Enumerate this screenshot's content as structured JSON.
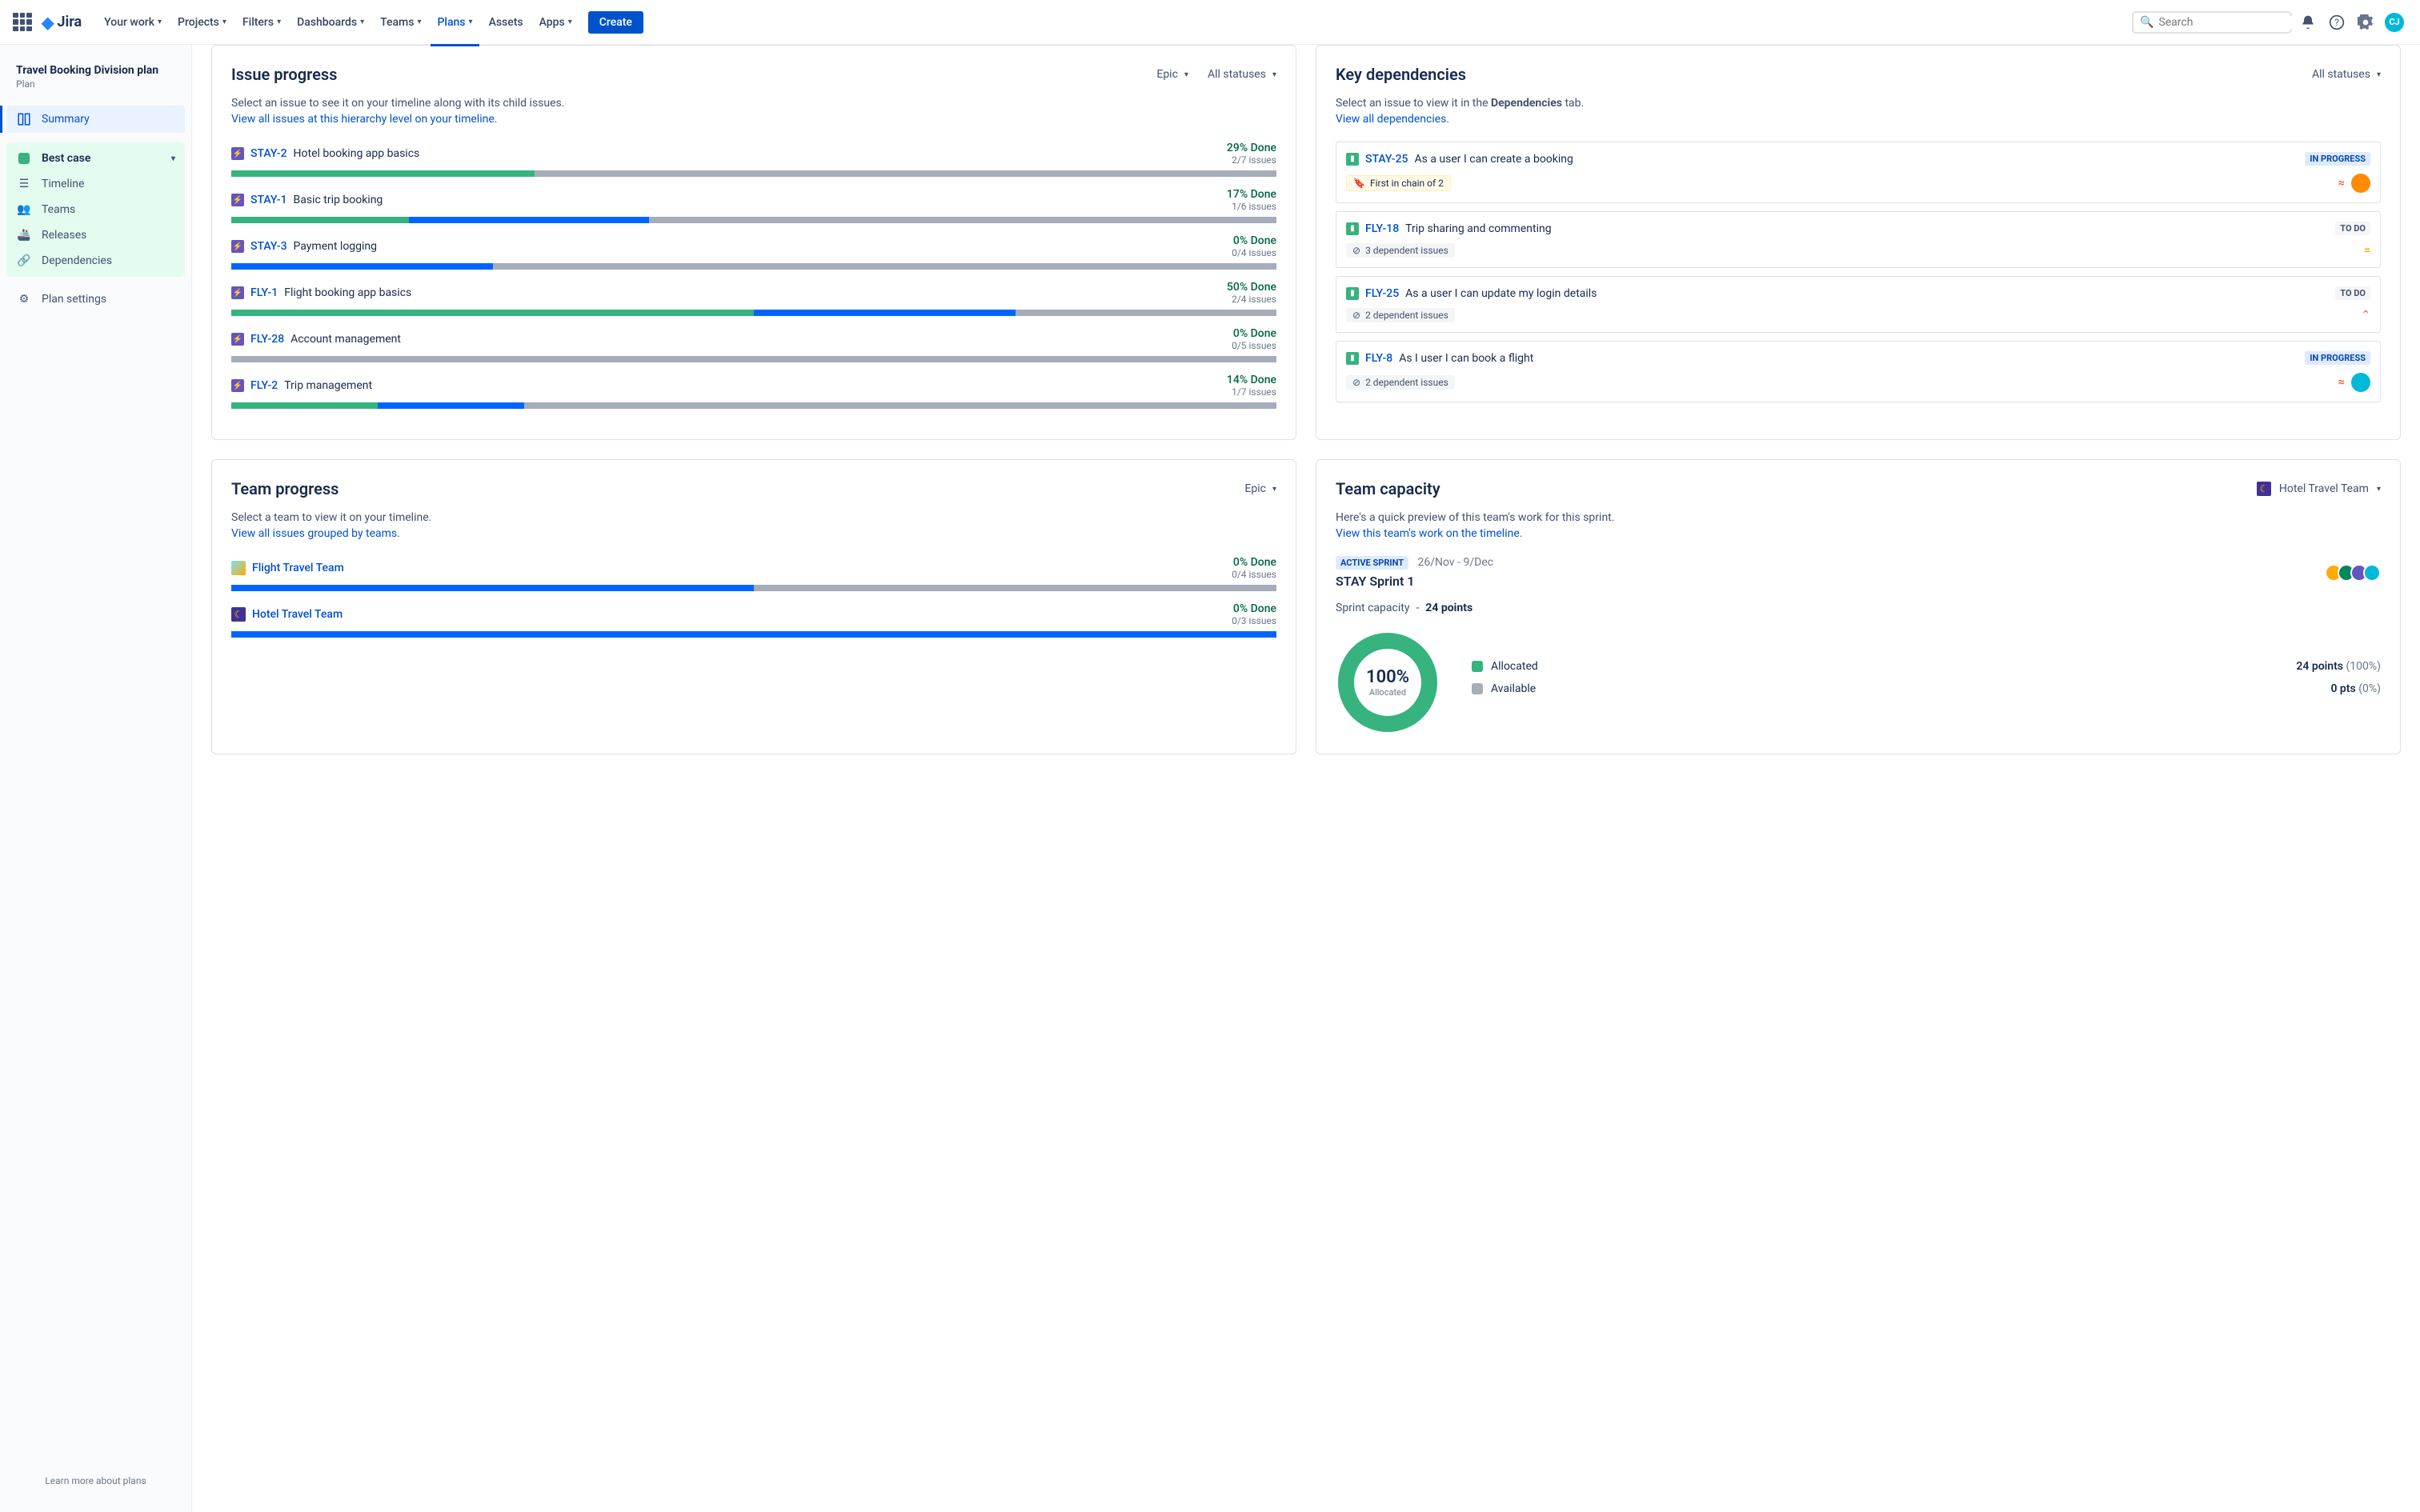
{
  "nav": {
    "logo": "Jira",
    "items": [
      "Your work",
      "Projects",
      "Filters",
      "Dashboards",
      "Teams",
      "Plans",
      "Assets",
      "Apps"
    ],
    "create": "Create",
    "search_placeholder": "Search"
  },
  "sidebar": {
    "plan_title": "Travel Booking Division plan",
    "plan_sub": "Plan",
    "summary": "Summary",
    "scenario": "Best case",
    "items": [
      "Timeline",
      "Teams",
      "Releases",
      "Dependencies"
    ],
    "settings": "Plan settings",
    "footer": "Learn more about plans"
  },
  "issue_progress": {
    "title": "Issue progress",
    "filter1": "Epic",
    "filter2": "All statuses",
    "desc": "Select an issue to see it on your timeline along with its child issues.",
    "link": "View all issues at this hierarchy level on your timeline.",
    "rows": [
      {
        "key": "STAY-2",
        "title": "Hotel booking app basics",
        "pct": "29% Done",
        "count": "2/7 issues",
        "green": 29,
        "blue": 0,
        "grey": 71
      },
      {
        "key": "STAY-1",
        "title": "Basic trip booking",
        "pct": "17% Done",
        "count": "1/6 issues",
        "green": 17,
        "blue": 23,
        "grey": 60
      },
      {
        "key": "STAY-3",
        "title": "Payment logging",
        "pct": "0% Done",
        "count": "0/4 issues",
        "green": 0,
        "blue": 25,
        "grey": 75
      },
      {
        "key": "FLY-1",
        "title": "Flight booking app basics",
        "pct": "50% Done",
        "count": "2/4 issues",
        "green": 50,
        "blue": 25,
        "grey": 25
      },
      {
        "key": "FLY-28",
        "title": "Account management",
        "pct": "0% Done",
        "count": "0/5 issues",
        "green": 0,
        "blue": 0,
        "grey": 100
      },
      {
        "key": "FLY-2",
        "title": "Trip management",
        "pct": "14% Done",
        "count": "1/7 issues",
        "green": 14,
        "blue": 14,
        "grey": 72
      }
    ]
  },
  "deps": {
    "title": "Key dependencies",
    "filter": "All statuses",
    "desc_a": "Select an issue to view it in the ",
    "desc_b": "Dependencies",
    "desc_c": " tab.",
    "link": "View all dependencies.",
    "rows": [
      {
        "key": "STAY-25",
        "title": "As a user I can create a booking",
        "status": "IN PROGRESS",
        "chain": "First in chain of 2",
        "prio": "highest",
        "avatar": "#FF8B00"
      },
      {
        "key": "FLY-18",
        "title": "Trip sharing and commenting",
        "status": "TO DO",
        "depcount": "3 dependent issues",
        "prio": "medium"
      },
      {
        "key": "FLY-25",
        "title": "As a user I can update my login details",
        "status": "TO DO",
        "depcount": "2 dependent issues",
        "prio": "high"
      },
      {
        "key": "FLY-8",
        "title": "As I user I can book a flight",
        "status": "IN PROGRESS",
        "depcount": "2 dependent issues",
        "prio": "highest",
        "avatar": "#00B8D9"
      }
    ]
  },
  "team_progress": {
    "title": "Team progress",
    "filter": "Epic",
    "desc": "Select a team to view it on your timeline.",
    "link": "View all issues grouped by teams.",
    "rows": [
      {
        "name": "Flight Travel Team",
        "pct": "0% Done",
        "count": "0/4 issues",
        "blue": 50,
        "grey": 50,
        "icon": "a"
      },
      {
        "name": "Hotel Travel Team",
        "pct": "0% Done",
        "count": "0/3 issues",
        "blue": 100,
        "grey": 0,
        "icon": "b"
      }
    ]
  },
  "capacity": {
    "title": "Team capacity",
    "team": "Hotel Travel Team",
    "desc": "Here's a quick preview of this team's work for this sprint.",
    "link": "View this team's work on the timeline.",
    "badge": "ACTIVE SPRINT",
    "dates": "26/Nov - 9/Dec",
    "sprint": "STAY Sprint 1",
    "cap_label": "Sprint capacity",
    "cap_sep": "-",
    "cap_val": "24 points",
    "donut_pct": "100%",
    "donut_lab": "Allocated",
    "legend": [
      {
        "label": "Allocated",
        "val": "24 points",
        "sub": "(100%)",
        "color": "#36B37E"
      },
      {
        "label": "Available",
        "val": "0 pts",
        "sub": "(0%)",
        "color": "#A5ADBA"
      }
    ]
  }
}
